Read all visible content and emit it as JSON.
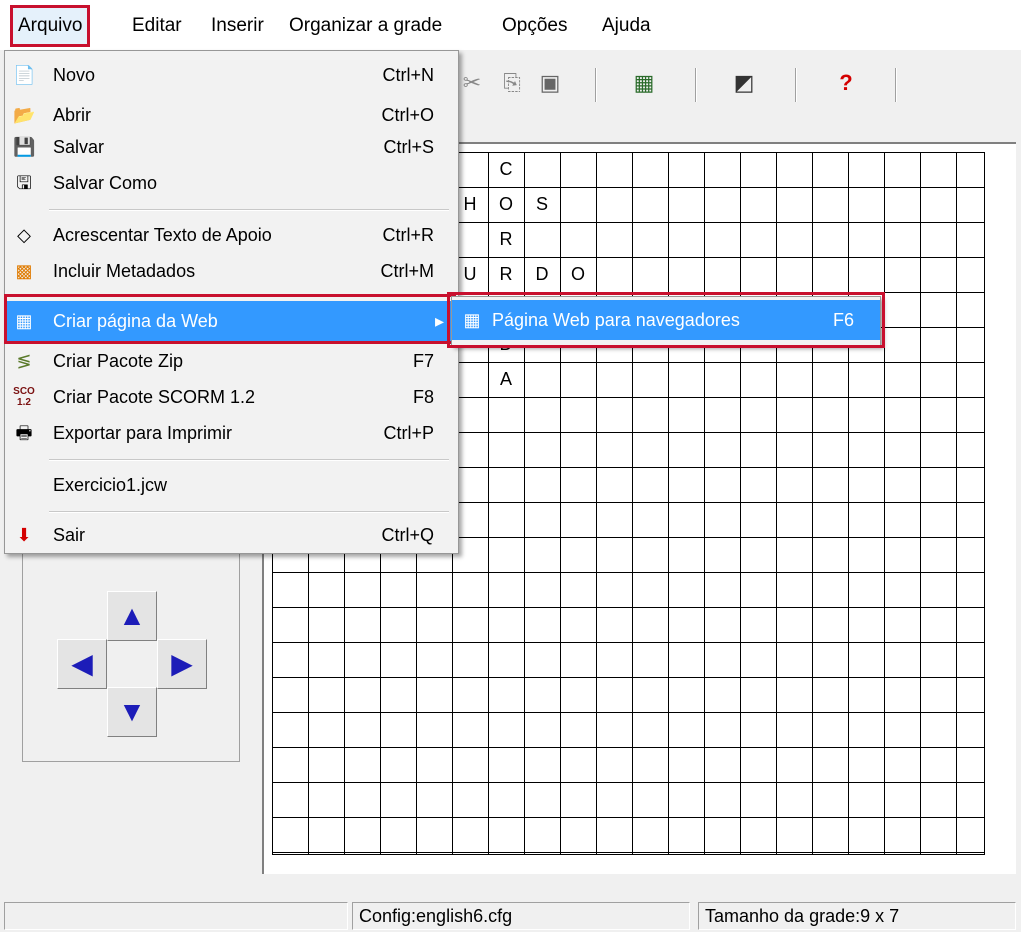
{
  "menubar": [
    "Arquivo",
    "Editar",
    "Inserir",
    "Organizar a grade",
    "Opções",
    "Ajuda"
  ],
  "file_menu": {
    "items": [
      {
        "label": "Novo",
        "shortcut": "Ctrl+N",
        "icon": "new-document-icon"
      },
      {
        "label": "Abrir",
        "shortcut": "Ctrl+O",
        "icon": "open-folder-icon"
      },
      {
        "label": "Salvar",
        "shortcut": "Ctrl+S",
        "icon": "save-disk-icon"
      },
      {
        "label": "Salvar Como",
        "shortcut": "",
        "icon": "save-as-icon"
      },
      {
        "label": "Acrescentar Texto de Apoio",
        "shortcut": "Ctrl+R",
        "icon": "add-text-icon"
      },
      {
        "label": "Incluir Metadados",
        "shortcut": "Ctrl+M",
        "icon": "metadata-icon"
      },
      {
        "label": "Criar página da Web",
        "shortcut": "",
        "icon": "web-page-icon"
      },
      {
        "label": "Criar Pacote Zip",
        "shortcut": "F7",
        "icon": "zip-icon"
      },
      {
        "label": "Criar Pacote SCORM 1.2",
        "shortcut": "F8",
        "icon": "scorm-icon"
      },
      {
        "label": "Exportar para Imprimir",
        "shortcut": "Ctrl+P",
        "icon": "printer-icon"
      },
      {
        "label": "Exercicio1.jcw",
        "shortcut": "",
        "icon": ""
      },
      {
        "label": "Sair",
        "shortcut": "Ctrl+Q",
        "icon": "exit-arrow-icon"
      }
    ],
    "scorm_icon_text": "SCO 1.2"
  },
  "submenu": {
    "label": "Página Web para navegadores",
    "shortcut": "F6",
    "icon": "web-browser-icon"
  },
  "grid_letters": {
    "r0": "C",
    "r1a": "H",
    "r1b": "O",
    "r1c": "S",
    "r2": "R",
    "r3a": "U",
    "r3b": "R",
    "r3c": "D",
    "r3d": "O",
    "r5": "D",
    "r6": "A"
  },
  "status": {
    "config": "Config:english6.cfg",
    "size": "Tamanho da grade:9 x 7"
  },
  "colors": {
    "highlight": "#3399ff",
    "annotation": "#c8102e",
    "arrow": "#1c1cb8"
  }
}
